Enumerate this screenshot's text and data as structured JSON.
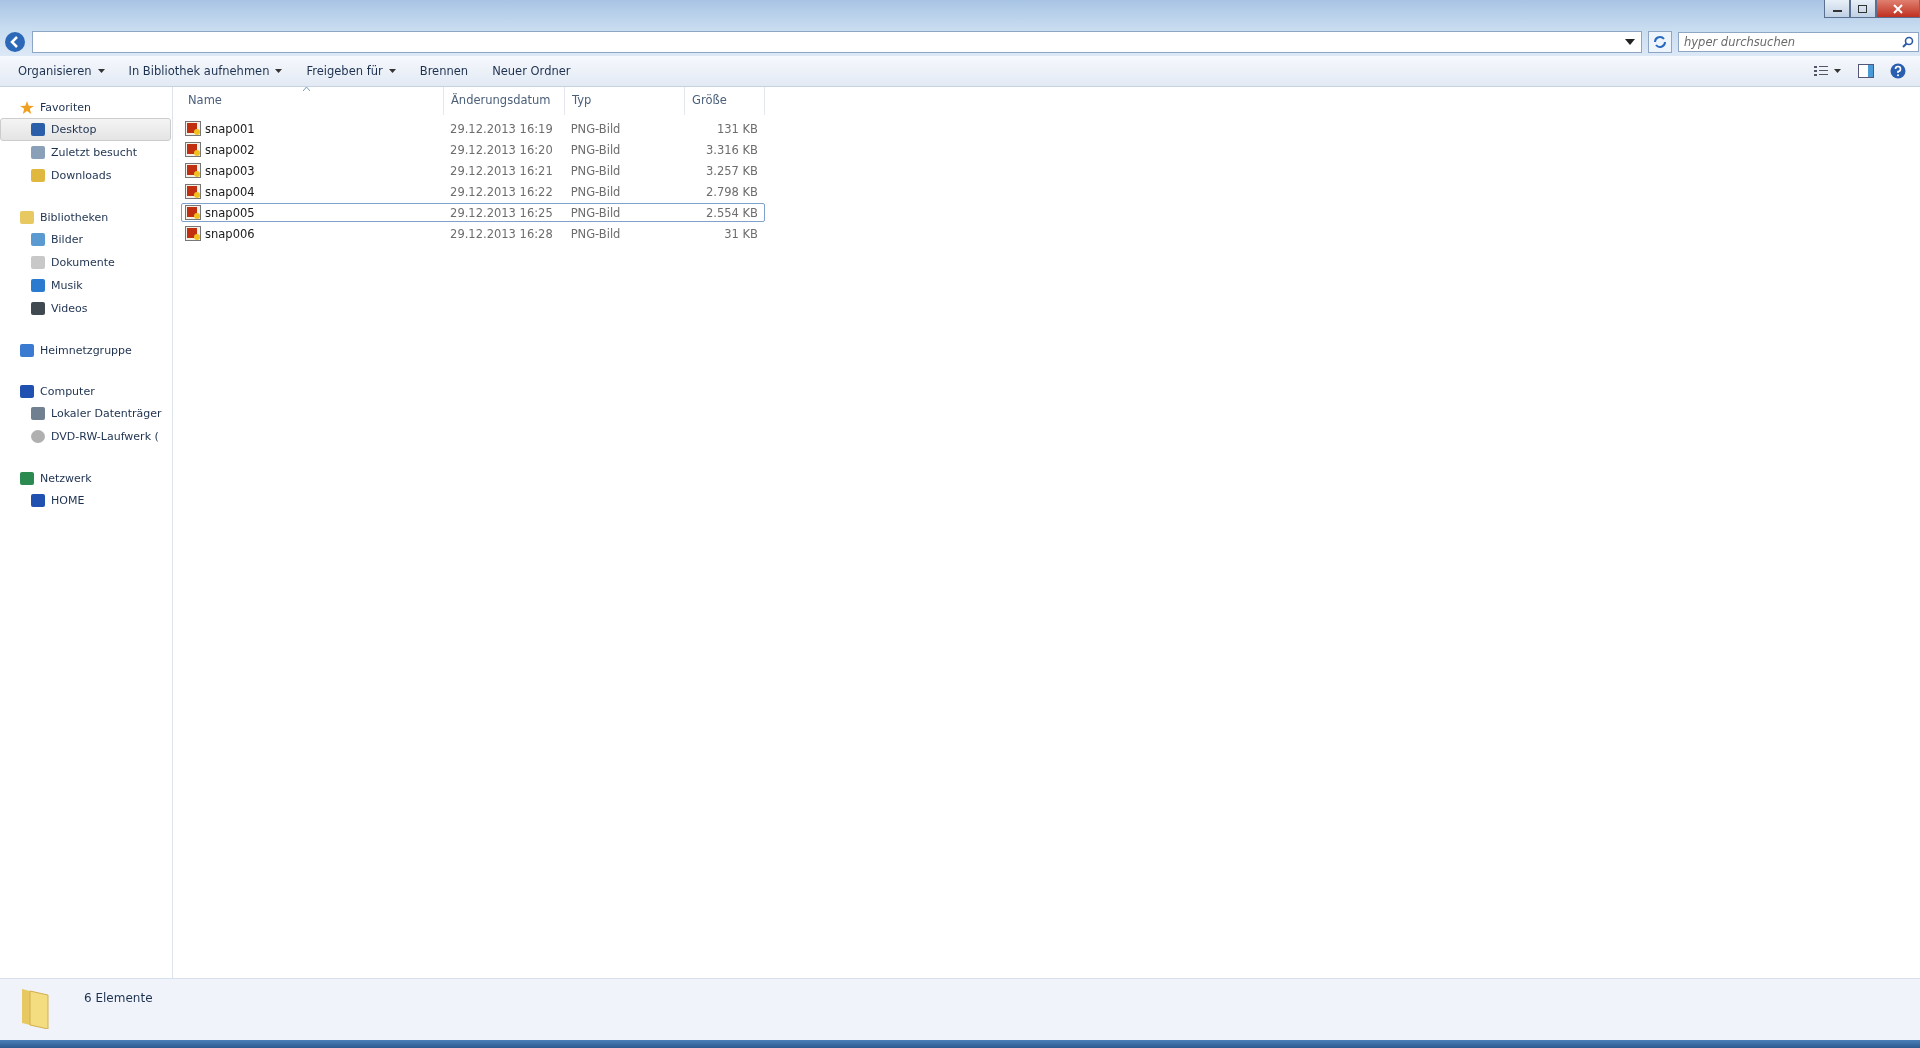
{
  "address_bar": {
    "search_placeholder": "hyper durchsuchen"
  },
  "toolbar": {
    "items": [
      {
        "label": "Organisieren",
        "dropdown": true
      },
      {
        "label": "In Bibliothek aufnehmen",
        "dropdown": true
      },
      {
        "label": "Freigeben für",
        "dropdown": true
      },
      {
        "label": "Brennen",
        "dropdown": false
      },
      {
        "label": "Neuer Ordner",
        "dropdown": false
      }
    ]
  },
  "sidebar": {
    "groups": [
      {
        "label": "Favoriten",
        "children": [
          {
            "label": "Desktop",
            "selected": true
          },
          {
            "label": "Zuletzt besucht",
            "selected": false
          },
          {
            "label": "Downloads",
            "selected": false
          }
        ]
      },
      {
        "label": "Bibliotheken",
        "children": [
          {
            "label": "Bilder",
            "selected": false
          },
          {
            "label": "Dokumente",
            "selected": false
          },
          {
            "label": "Musik",
            "selected": false
          },
          {
            "label": "Videos",
            "selected": false
          }
        ]
      },
      {
        "label": "Heimnetzgruppe"
      },
      {
        "label": "Computer",
        "children": [
          {
            "label": "Lokaler Datenträger",
            "selected": false
          },
          {
            "label": "DVD-RW-Laufwerk (",
            "selected": false
          }
        ]
      },
      {
        "label": "Netzwerk",
        "children": [
          {
            "label": "HOME",
            "selected": false
          }
        ]
      }
    ]
  },
  "table": {
    "columns": [
      "Name",
      "Änderungsdatum",
      "Typ",
      "Größe"
    ],
    "rows": [
      {
        "name": "snap001",
        "date": "29.12.2013 16:19",
        "type": "PNG-Bild",
        "size": "131 KB",
        "selected": false
      },
      {
        "name": "snap002",
        "date": "29.12.2013 16:20",
        "type": "PNG-Bild",
        "size": "3.316 KB",
        "selected": false
      },
      {
        "name": "snap003",
        "date": "29.12.2013 16:21",
        "type": "PNG-Bild",
        "size": "3.257 KB",
        "selected": false
      },
      {
        "name": "snap004",
        "date": "29.12.2013 16:22",
        "type": "PNG-Bild",
        "size": "2.798 KB",
        "selected": false
      },
      {
        "name": "snap005",
        "date": "29.12.2013 16:25",
        "type": "PNG-Bild",
        "size": "2.554 KB",
        "selected": true
      },
      {
        "name": "snap006",
        "date": "29.12.2013 16:28",
        "type": "PNG-Bild",
        "size": "31 KB",
        "selected": false
      }
    ]
  },
  "status_bar": {
    "text": "6 Elemente"
  }
}
